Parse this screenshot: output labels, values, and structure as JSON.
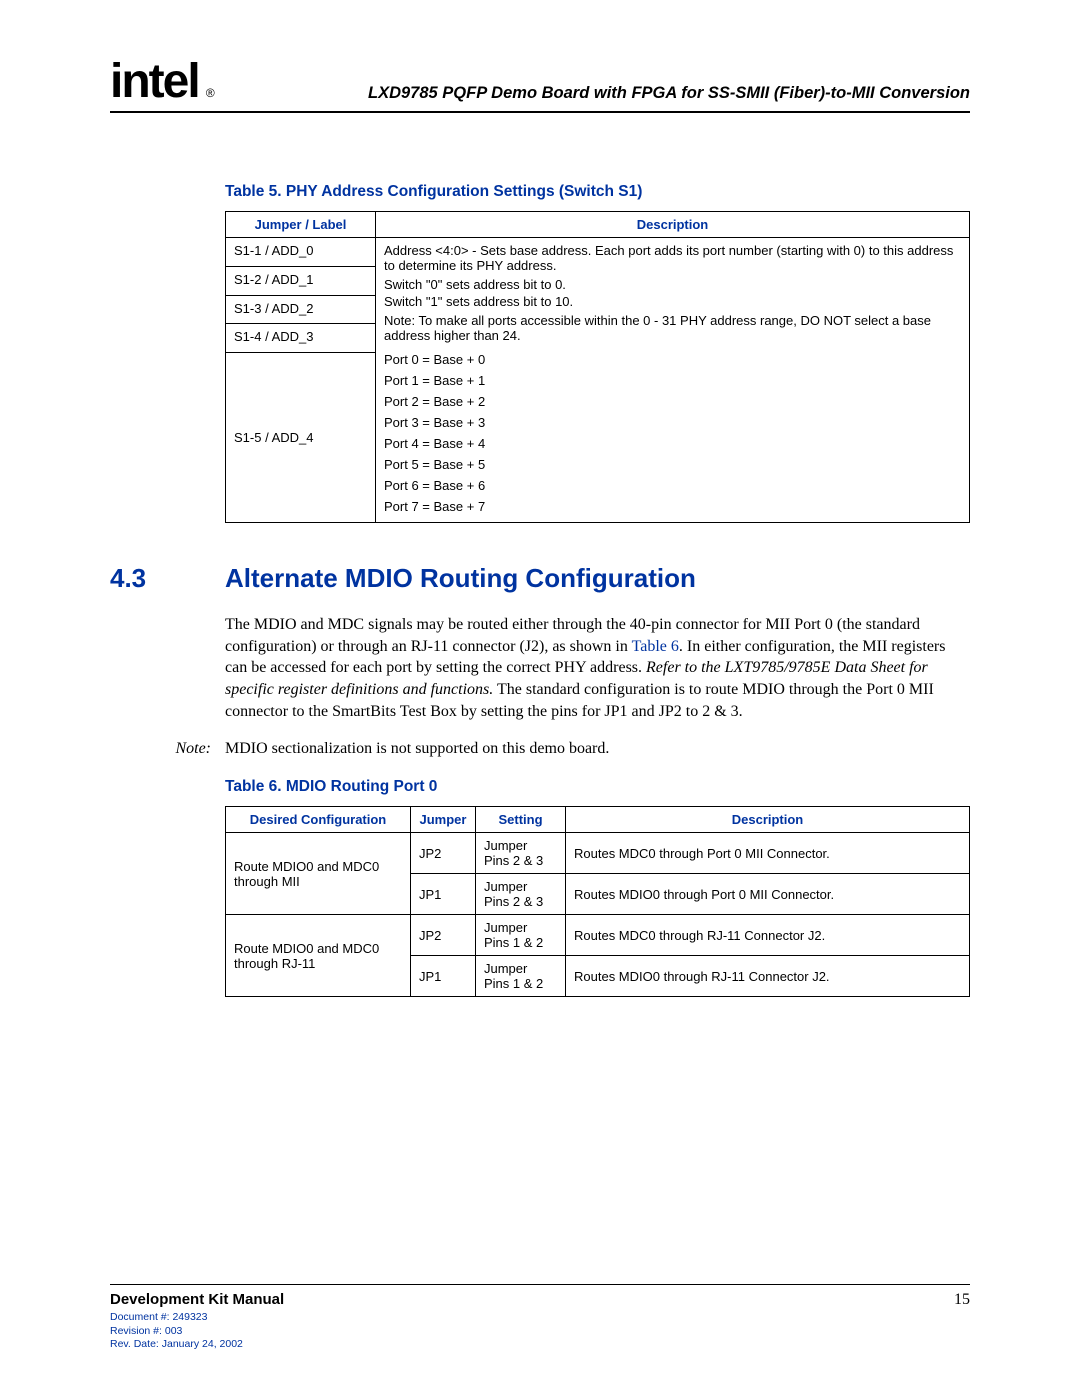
{
  "header": {
    "logo_text": "intel",
    "reg": "®",
    "doc_title": "LXD9785 PQFP Demo Board with FPGA for SS-SMII (Fiber)-to-MII Conversion"
  },
  "table5": {
    "caption": "Table 5.   PHY Address Configuration Settings (Switch S1)",
    "head_jumper": "Jumper / Label",
    "head_desc": "Description",
    "rows": [
      {
        "jumper": "S1-1 / ADD_0"
      },
      {
        "jumper": "S1-2 / ADD_1"
      },
      {
        "jumper": "S1-3 / ADD_2"
      },
      {
        "jumper": "S1-4 / ADD_3"
      },
      {
        "jumper": "S1-5 / ADD_4"
      }
    ],
    "desc_line1": "Address <4:0> - Sets base address. Each port adds its port number (starting with 0) to this address to determine its PHY address.",
    "desc_line2": "Switch \"0\" sets address bit to 0.",
    "desc_line3": "Switch \"1\" sets address bit to 10.",
    "desc_line4": "Note: To make all ports accessible within the 0 - 31 PHY address range, DO NOT select a base address higher than 24.",
    "ports": [
      "Port 0 = Base + 0",
      "Port 1 = Base + 1",
      "Port 2 = Base + 2",
      "Port 3 = Base + 3",
      "Port 4 = Base + 4",
      "Port 5 = Base + 5",
      "Port 6 = Base + 6",
      "Port 7 = Base + 7"
    ]
  },
  "section": {
    "num": "4.3",
    "title": "Alternate MDIO Routing Configuration",
    "para_pre": "The MDIO and MDC signals may be routed either through the 40-pin connector for MII Port 0 (the standard configuration) or through an RJ-11 connector (J2), as shown in ",
    "para_link": "Table 6",
    "para_mid": ". In either configuration, the MII registers can be accessed for each port by setting the correct PHY address. ",
    "para_em": "Refer to the LXT9785/9785E Data Sheet for specific register definitions and functions.",
    "para_post": " The standard configuration is to route MDIO through the Port 0 MII connector to the SmartBits Test Box by setting the pins for JP1 and JP2 to 2 & 3.",
    "note_label": "Note:",
    "note_text": "MDIO sectionalization is not supported on this demo board."
  },
  "table6": {
    "caption": "Table 6.   MDIO Routing Port 0",
    "head_dc": "Desired Configuration",
    "head_jp": "Jumper",
    "head_st": "Setting",
    "head_ds": "Description",
    "groups": [
      {
        "dc": "Route MDIO0 and MDC0 through MII",
        "rows": [
          {
            "jp": "JP2",
            "st1": "Jumper",
            "st2": "Pins 2 & 3",
            "ds": "Routes MDC0 through Port 0 MII Connector."
          },
          {
            "jp": "JP1",
            "st1": "Jumper",
            "st2": "Pins 2 & 3",
            "ds": "Routes MDIO0 through Port 0 MII Connector."
          }
        ]
      },
      {
        "dc": "Route MDIO0 and MDC0 through RJ-11",
        "rows": [
          {
            "jp": "JP2",
            "st1": "Jumper",
            "st2": "Pins 1 & 2",
            "ds": "Routes MDC0 through RJ-11 Connector J2."
          },
          {
            "jp": "JP1",
            "st1": "Jumper",
            "st2": "Pins 1 & 2",
            "ds": "Routes MDIO0 through RJ-11 Connector J2."
          }
        ]
      }
    ]
  },
  "footer": {
    "title": "Development Kit Manual",
    "doc_num": "Document #: 249323",
    "rev_num": "Revision #: 003",
    "rev_date": "Rev. Date: January 24, 2002",
    "page": "15"
  }
}
